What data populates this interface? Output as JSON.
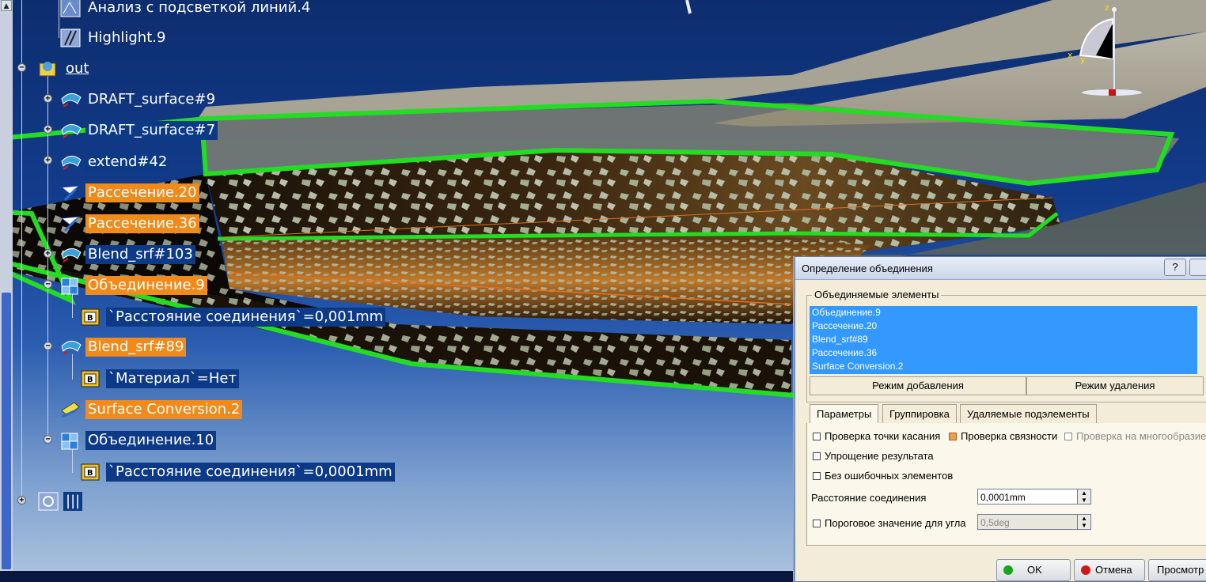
{
  "tree": {
    "items": [
      {
        "label": "Анализ с подсветкой линий.4",
        "style": "plain"
      },
      {
        "label": "Highlight.9",
        "style": "plain"
      },
      {
        "label": "out",
        "style": "underline"
      },
      {
        "label": "DRAFT_surface#9",
        "style": "plain"
      },
      {
        "label": "DRAFT_surface#7",
        "style": "selected"
      },
      {
        "label": "extend#42",
        "style": "selected"
      },
      {
        "label": "Рассечение.20",
        "style": "orange"
      },
      {
        "label": "Рассечение.36",
        "style": "orange"
      },
      {
        "label": "Blend_srf#103",
        "style": "selected"
      },
      {
        "label": "Объединение.9",
        "style": "orange"
      },
      {
        "label": "`Расстояние соединения`=0,001mm",
        "style": "selected"
      },
      {
        "label": "Blend_srf#89",
        "style": "orange"
      },
      {
        "label": "`Материал`=Нет",
        "style": "selected"
      },
      {
        "label": "Surface Conversion.2",
        "style": "orange"
      },
      {
        "label": "Объединение.10",
        "style": "selected"
      },
      {
        "label": "`Расстояние соединения`=0,0001mm",
        "style": "selected"
      },
      {
        "label": "|||",
        "style": "selected"
      }
    ]
  },
  "compass": {
    "z": "z",
    "x": "x",
    "y": "y"
  },
  "dialog": {
    "title": "Определение объединения",
    "help": "?",
    "elements_group": "Объединяемые элементы",
    "elements": [
      "Объединение.9",
      "Рассечение.20",
      "Blend_srf#89",
      "Рассечение.36",
      "Surface Conversion.2"
    ],
    "add_mode": "Режим добавления",
    "remove_mode": "Режим удаления",
    "tabs": [
      "Параметры",
      "Группировка",
      "Удаляемые подэлементы"
    ],
    "checks": {
      "tangency": "Проверка точки касания",
      "connexity": "Проверка связности",
      "manifold": "Проверка на многообразие",
      "simplify": "Упрощение результата",
      "no_invalid": "Без ошибочных элементов"
    },
    "distance_label": "Расстояние соединения",
    "distance_value": "0,0001mm",
    "angle_label": "Пороговое значение для угла",
    "angle_value": "0,5deg",
    "ok": "OK",
    "cancel": "Отмена",
    "preview": "Просмотр"
  },
  "colors": {
    "tree_selected": "#0d3a86",
    "tree_orange": "#f08a1a",
    "edge_green": "#22dd22",
    "annotation_red": "#e01010",
    "list_selected": "#3399ff",
    "dialog_bg": "#f3ecd8"
  }
}
